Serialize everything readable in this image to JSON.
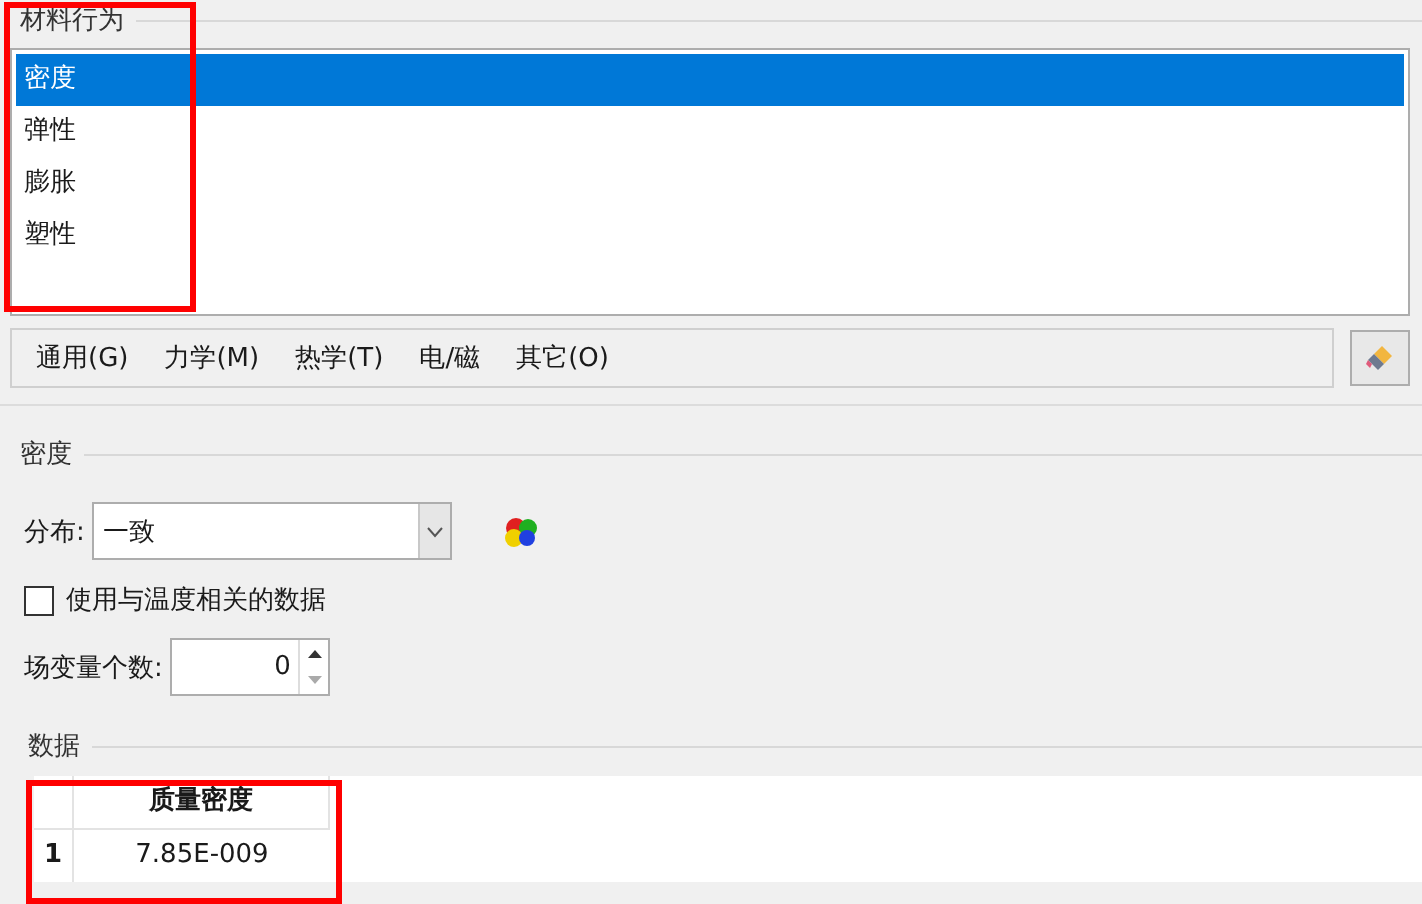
{
  "behaviors": {
    "title": "材料行为",
    "items": [
      {
        "label": "密度",
        "selected": true
      },
      {
        "label": "弹性",
        "selected": false
      },
      {
        "label": "膨胀",
        "selected": false
      },
      {
        "label": "塑性",
        "selected": false
      }
    ]
  },
  "menu": [
    "通用(G)",
    "力学(M)",
    "热学(T)",
    "电/磁",
    "其它(O)"
  ],
  "section": {
    "title": "密度",
    "distribution": {
      "label": "分布:",
      "value": "一致"
    },
    "temp_dependent": {
      "label": "使用与温度相关的数据",
      "checked": false
    },
    "field_vars": {
      "label": "场变量个数:",
      "value": "0"
    },
    "data": {
      "title": "数据",
      "columns": [
        "质量密度"
      ],
      "rows": [
        {
          "index": "1",
          "cells": [
            "7.85E-009"
          ]
        }
      ]
    }
  }
}
